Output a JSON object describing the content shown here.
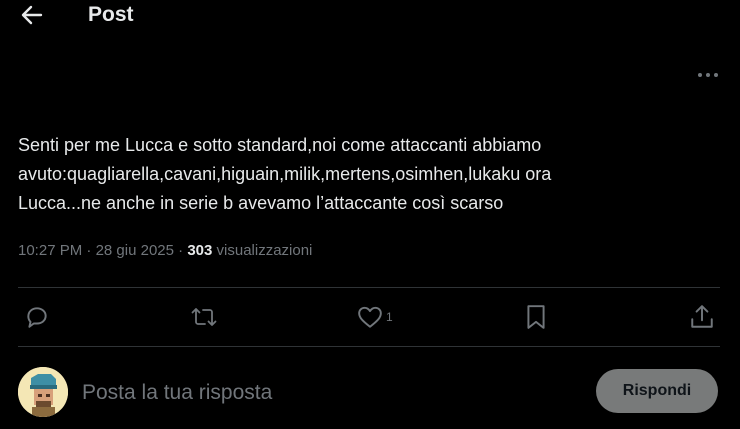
{
  "header": {
    "title": "Post",
    "back_icon": "arrow-left-icon"
  },
  "post": {
    "more_icon": "more-horizontal-icon",
    "text": "Senti per me Lucca e sotto standard,noi come attaccanti abbiamo\navuto:quagliarella,cavani,higuain,milik,mertens,osimhen,lukaku ora\nLucca...ne anche in serie b avevamo l’attaccante così scarso",
    "time": "10:27 PM",
    "date": "28 giu 2025",
    "separator": "·",
    "views_count": "303",
    "views_label": "visualizzazioni"
  },
  "actions": {
    "reply_icon": "reply-icon",
    "repost_icon": "repost-icon",
    "like_icon": "heart-icon",
    "like_count": "1",
    "bookmark_icon": "bookmark-icon",
    "share_icon": "share-icon"
  },
  "reply": {
    "placeholder": "Posta la tua risposta",
    "button_label": "Rispondi"
  },
  "colors": {
    "background": "#000000",
    "text": "#e7e9ea",
    "muted": "#71767b",
    "divider": "#2f3336",
    "button_bg": "#787a7a"
  }
}
